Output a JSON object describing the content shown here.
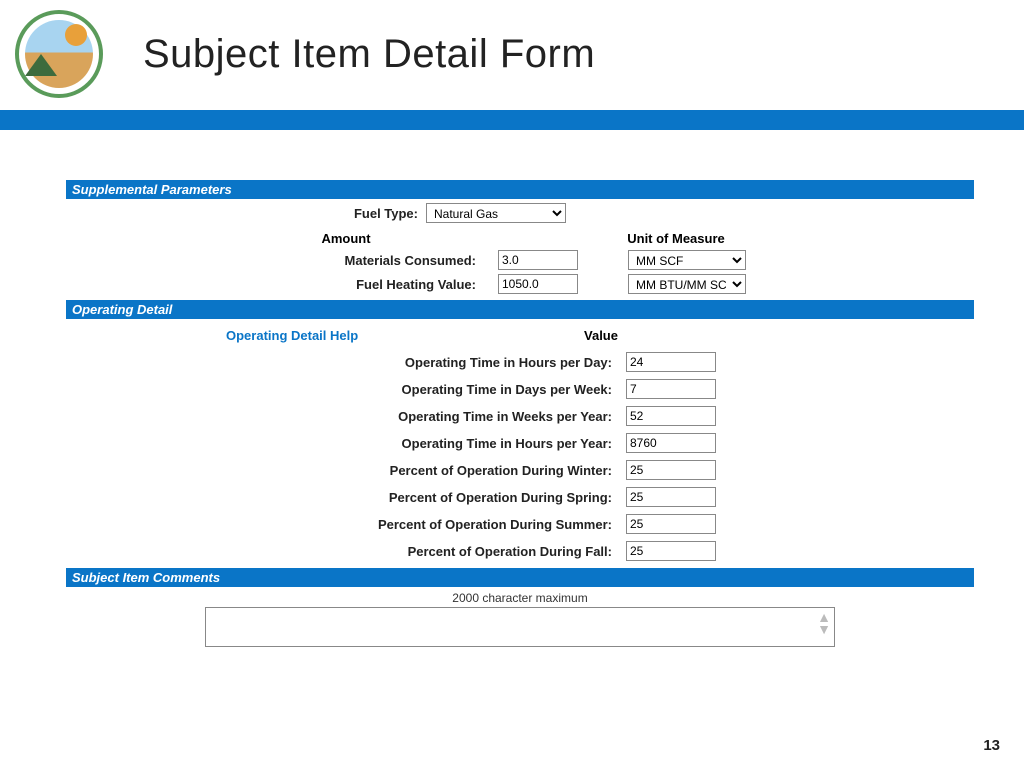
{
  "header": {
    "title": "Subject Item Detail Form",
    "logo_alt": "New Mexico Environment Department"
  },
  "sections": {
    "supplemental": {
      "title": "Supplemental Parameters",
      "fuel_type_label": "Fuel Type:",
      "fuel_type_value": "Natural Gas",
      "col_amount": "Amount",
      "col_uom": "Unit of Measure",
      "materials_consumed_label": "Materials Consumed:",
      "materials_consumed_amount": "3.0",
      "materials_consumed_uom": "MM SCF",
      "fuel_heating_label": "Fuel Heating Value:",
      "fuel_heating_amount": "1050.0",
      "fuel_heating_uom": "MM BTU/MM SCF"
    },
    "operating": {
      "title": "Operating Detail",
      "help_link": "Operating Detail Help",
      "value_header": "Value",
      "rows": [
        {
          "label": "Operating Time in Hours per Day:",
          "value": "24"
        },
        {
          "label": "Operating Time in Days per Week:",
          "value": "7"
        },
        {
          "label": "Operating Time in Weeks per Year:",
          "value": "52"
        },
        {
          "label": "Operating Time in Hours per Year:",
          "value": "8760"
        },
        {
          "label": "Percent of Operation During Winter:",
          "value": "25"
        },
        {
          "label": "Percent of Operation During Spring:",
          "value": "25"
        },
        {
          "label": "Percent of Operation During Summer:",
          "value": "25"
        },
        {
          "label": "Percent of Operation During Fall:",
          "value": "25"
        }
      ]
    },
    "comments": {
      "title": "Subject Item Comments",
      "note": "2000 character maximum",
      "value": ""
    }
  },
  "page_number": "13"
}
